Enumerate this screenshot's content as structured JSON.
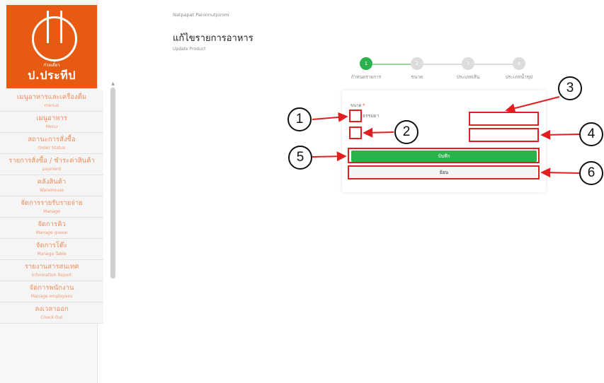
{
  "logo": {
    "sub": "ก๋วยเตี๋ยว",
    "name": "ป.ประทีป"
  },
  "sidebar": {
    "items": [
      {
        "th": "เมนูอาหารและเครื่องดื่ม",
        "en": "menus"
      },
      {
        "th": "เมนูอาหาร",
        "en": "Menu"
      },
      {
        "th": "สถานะการสั่งซื้อ",
        "en": "Order Status"
      },
      {
        "th": "รายการสั่งซื้อ / ชำระค่าสินค้า",
        "en": "payment"
      },
      {
        "th": "คลังสินค้า",
        "en": "WareHouse"
      },
      {
        "th": "จัดการรายรับรายจ่าย",
        "en": "Manage"
      },
      {
        "th": "จัดการคิว",
        "en": "Manage queue"
      },
      {
        "th": "จัดการโต๊ะ",
        "en": "Manage Table"
      },
      {
        "th": "รายงานสารสนเทศ",
        "en": "Information Report"
      },
      {
        "th": "จัดการพนักงาน",
        "en": "Manage employees"
      },
      {
        "th": "ลงเวลาออก",
        "en": "Check Out"
      }
    ]
  },
  "header": {
    "user": "Natpapat Paninnutpirom",
    "title": "แก้ไขรายการอาหาร",
    "subtitle": "Update Product"
  },
  "stepper": {
    "steps": [
      {
        "number": "1",
        "label": "กำหนดรายการ",
        "active": true
      },
      {
        "number": "2",
        "label": "ขนาด",
        "active": false
      },
      {
        "number": "3",
        "label": "ประเภทเส้น",
        "active": false
      },
      {
        "number": "4",
        "label": "ประเภทน้ำซุป",
        "active": false
      }
    ]
  },
  "form": {
    "size_label": "ขนาด",
    "required_mark": "*",
    "option1_label": "ธรรมดา",
    "save_label": "บันทึก",
    "back_label": "ย้อน"
  },
  "callouts": [
    "1",
    "2",
    "3",
    "4",
    "5",
    "6"
  ],
  "colors": {
    "accent": "#e65a12",
    "save": "#2bb24c",
    "highlight": "#e02020"
  }
}
